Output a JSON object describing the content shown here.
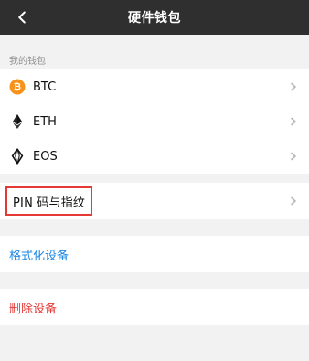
{
  "header": {
    "title": "硬件钱包",
    "back_icon": "chevron-left-icon"
  },
  "wallets": {
    "section_title": "我的钱包",
    "items": [
      {
        "label": "BTC",
        "icon": "bitcoin-icon",
        "accent": "#f7931a"
      },
      {
        "label": "ETH",
        "icon": "ethereum-icon",
        "accent": "#111111"
      },
      {
        "label": "EOS",
        "icon": "eos-icon",
        "accent": "#111111"
      }
    ]
  },
  "security": {
    "pin_label": "PIN 码与指纹",
    "highlight_color": "#e53935"
  },
  "actions": {
    "format_label": "格式化设备",
    "format_color": "#1e88e5",
    "delete_label": "删除设备",
    "delete_color": "#e53935"
  }
}
